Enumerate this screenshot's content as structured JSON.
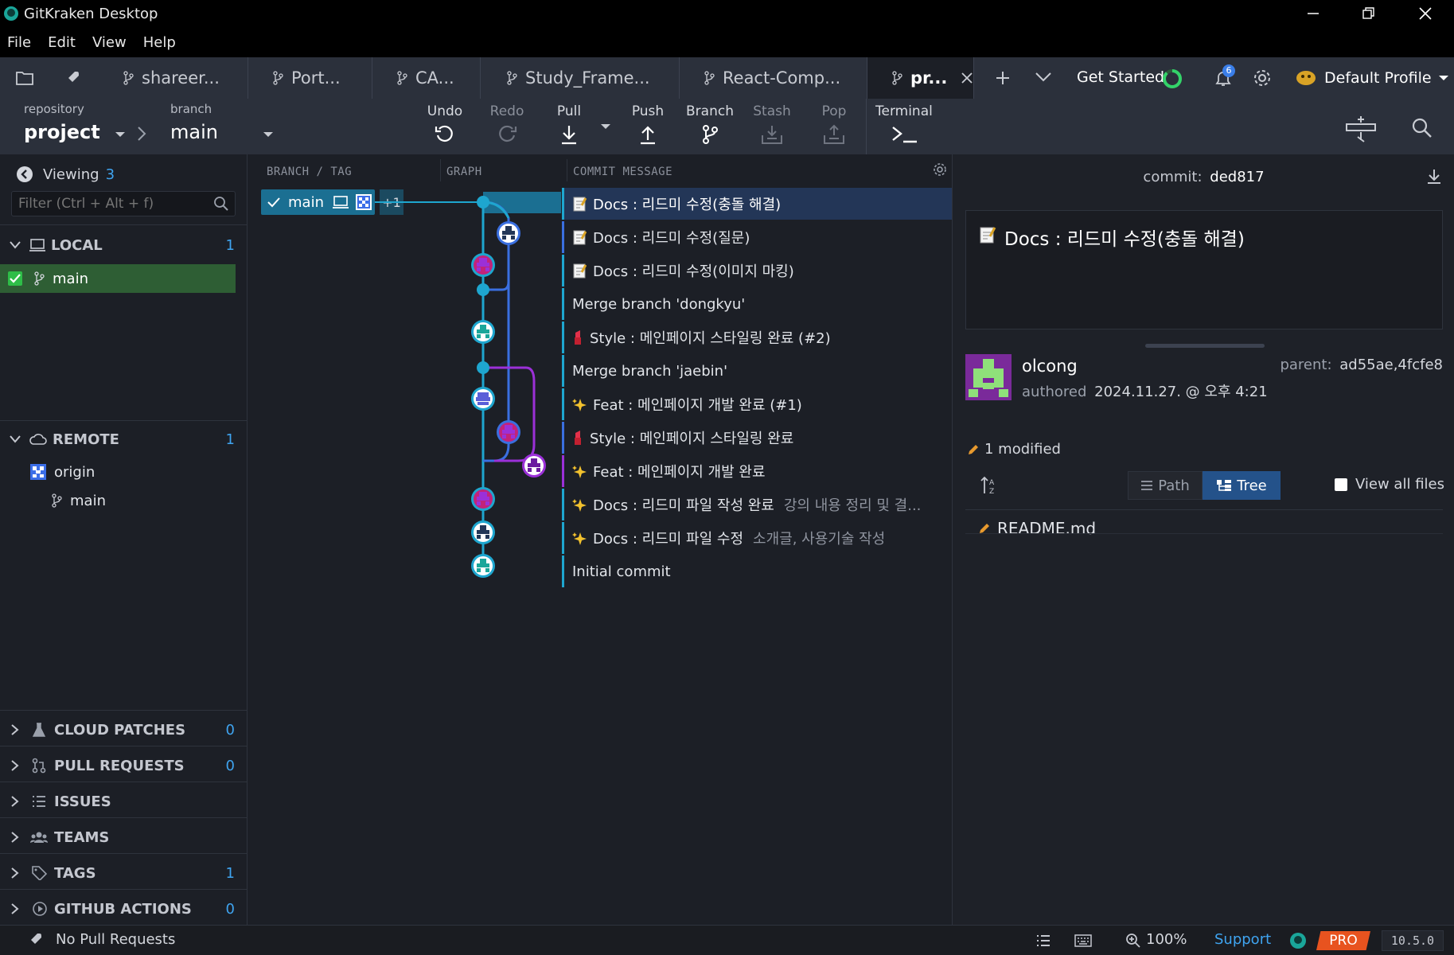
{
  "window": {
    "title": "GitKraken Desktop"
  },
  "menu": [
    "File",
    "Edit",
    "View",
    "Help"
  ],
  "tabs": [
    {
      "label": "shareer..."
    },
    {
      "label": "Port..."
    },
    {
      "label": "CA..."
    },
    {
      "label": "Study_Frame..."
    },
    {
      "label": "React-Comp..."
    },
    {
      "label": "pr...",
      "active": true
    }
  ],
  "header_right": {
    "get_started": "Get Started",
    "notification_count": "6",
    "profile": "Default Profile"
  },
  "toolbar": {
    "repository_label": "repository",
    "repository_value": "project",
    "branch_label": "branch",
    "branch_value": "main",
    "undo": "Undo",
    "redo": "Redo",
    "pull": "Pull",
    "push": "Push",
    "branch": "Branch",
    "stash": "Stash",
    "pop": "Pop",
    "terminal": "Terminal"
  },
  "left_panel": {
    "viewing_label": "Viewing",
    "viewing_count": "3",
    "filter_placeholder": "Filter (Ctrl + Alt + f)",
    "local": {
      "label": "LOCAL",
      "count": "1",
      "branches": [
        "main"
      ]
    },
    "remote": {
      "label": "REMOTE",
      "count": "1",
      "origin": "origin",
      "branches": [
        "main"
      ]
    },
    "sections": [
      {
        "label": "CLOUD PATCHES",
        "count": "0",
        "icon": "flask-icon"
      },
      {
        "label": "PULL REQUESTS",
        "count": "0",
        "icon": "pull-request-icon"
      },
      {
        "label": "ISSUES",
        "count": "",
        "icon": "list-icon"
      },
      {
        "label": "TEAMS",
        "count": "",
        "icon": "team-icon"
      },
      {
        "label": "TAGS",
        "count": "1",
        "icon": "tag-icon"
      },
      {
        "label": "GITHUB ACTIONS",
        "count": "0",
        "icon": "play-circle-icon"
      }
    ]
  },
  "graph": {
    "col_branch": "BRANCH / TAG",
    "col_graph": "GRAPH",
    "col_message": "COMMIT MESSAGE",
    "branch_tag": "main",
    "branch_extra": "+1",
    "commits": [
      {
        "message": "Docs : 리드미 수정(충돌 해결)",
        "description": "",
        "emoji": "memo"
      },
      {
        "message": "Docs : 리드미 수정(질문)",
        "description": "",
        "emoji": "memo"
      },
      {
        "message": "Docs : 리드미 수정(이미지 마킹)",
        "description": "",
        "emoji": "memo"
      },
      {
        "message": "Merge branch 'dongkyu'",
        "description": "",
        "emoji": ""
      },
      {
        "message": "Style : 메인페이지 스타일링 완료 (#2)",
        "description": "",
        "emoji": "lipstick"
      },
      {
        "message": "Merge branch 'jaebin'",
        "description": "",
        "emoji": ""
      },
      {
        "message": "Feat : 메인페이지 개발 완료 (#1)",
        "description": "",
        "emoji": "sparkles"
      },
      {
        "message": "Style : 메인페이지 스타일링 완료",
        "description": "",
        "emoji": "lipstick"
      },
      {
        "message": "Feat : 메인페이지 개발 완료",
        "description": "",
        "emoji": "sparkles"
      },
      {
        "message": "Docs : 리드미 파일 작성 완료",
        "description": "강의 내용 정리 및 결...",
        "emoji": "sparkles"
      },
      {
        "message": "Docs : 리드미 파일 수정",
        "description": "소개글, 사용기술 작성",
        "emoji": "sparkles"
      },
      {
        "message": "Initial commit",
        "description": "",
        "emoji": ""
      }
    ]
  },
  "detail": {
    "commit_label": "commit:",
    "commit_sha": "ded817",
    "summary": "Docs : 리드미 수정(충돌 해결)",
    "author": "olcong",
    "authored_label": "authored",
    "authored_date": "2024.11.27. @ 오후 4:21",
    "parent_label": "parent:",
    "parent_value": "ad55ae,4fcfe8",
    "modified": "1 modified",
    "view_path": "Path",
    "view_tree": "Tree",
    "view_all_files": "View all files",
    "files": [
      "README.md"
    ]
  },
  "status": {
    "pull_requests": "No Pull Requests",
    "zoom": "100%",
    "support": "Support",
    "pro": "PRO",
    "version": "10.5.0"
  },
  "colors": {
    "accent_blue": "#1ea6cf",
    "branch_purple": "#9b30d8",
    "branch_blue": "#3a6fe0",
    "local_selected": "#2e5e34",
    "pro_orange": "#e8531f"
  }
}
